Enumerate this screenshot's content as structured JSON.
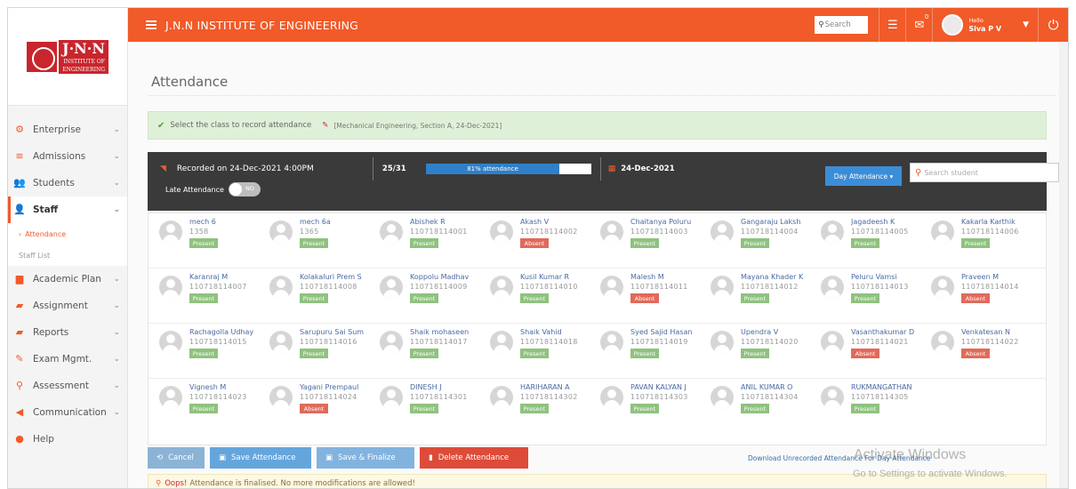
{
  "sidebar": {
    "logo_main": "J·N·N",
    "logo_sub1": "INSTITUTE OF",
    "logo_sub2": "ENGINEERING",
    "items": [
      {
        "label": "Enterprise",
        "icon": "gears-icon"
      },
      {
        "label": "Admissions",
        "icon": "list-icon"
      },
      {
        "label": "Students",
        "icon": "users-icon"
      },
      {
        "label": "Staff",
        "icon": "user-icon"
      },
      {
        "label": "Academic Plan",
        "icon": "folder-icon"
      },
      {
        "label": "Assignment",
        "icon": "book-icon"
      },
      {
        "label": "Reports",
        "icon": "folder-open-icon"
      },
      {
        "label": "Exam Mgmt.",
        "icon": "edit-icon"
      },
      {
        "label": "Assessment",
        "icon": "search-icon"
      },
      {
        "label": "Communication",
        "icon": "megaphone-icon"
      },
      {
        "label": "Help",
        "icon": "question-icon"
      }
    ],
    "staff_sub": [
      {
        "label": "Attendance"
      },
      {
        "label": "Staff List"
      }
    ]
  },
  "topbar": {
    "title": "J.N.N INSTITUTE OF ENGINEERING",
    "search_placeholder": "Search",
    "mail_badge": "0",
    "hello": "Hello",
    "user_name": "Siva P V",
    "accent": "#f15a29"
  },
  "page": {
    "title": "Attendance",
    "notice_text": "Select the class to record attendance",
    "notice_detail": "[Mechanical Engineering, Section A, 24-Dec-2021]",
    "recorded_on": "Recorded on  24-Dec-2021 4:00PM",
    "count": "25/31",
    "progress_label": "81% attendance",
    "progress": 0.81,
    "date": "24-Dec-2021",
    "day_attendance_label": "Day Attendance ▾",
    "search_student_placeholder": "Search student",
    "late_attendance_label": "Late Attendance",
    "toggle_label": "NO"
  },
  "students": [
    {
      "name": "mech 6",
      "id": "1358",
      "status": "Present"
    },
    {
      "name": "mech 6a",
      "id": "1365",
      "status": "Present"
    },
    {
      "name": "Abishek R",
      "id": "110718114001",
      "status": "Present"
    },
    {
      "name": "Akash V",
      "id": "110718114002",
      "status": "Absent"
    },
    {
      "name": "Chaitanya Poluru",
      "id": "110718114003",
      "status": "Present"
    },
    {
      "name": "Gangaraju Laksh",
      "id": "110718114004",
      "status": "Present"
    },
    {
      "name": "Jagadeesh K",
      "id": "110718114005",
      "status": "Present"
    },
    {
      "name": "Kakarla Karthik",
      "id": "110718114006",
      "status": "Present"
    },
    {
      "name": "Karanraj M",
      "id": "110718114007",
      "status": "Present"
    },
    {
      "name": "Kolakaluri Prem S",
      "id": "110718114008",
      "status": "Present"
    },
    {
      "name": "Koppolu Madhav",
      "id": "110718114009",
      "status": "Present"
    },
    {
      "name": "Kusil Kumar R",
      "id": "110718114010",
      "status": "Present"
    },
    {
      "name": "Malesh M",
      "id": "110718114011",
      "status": "Absent"
    },
    {
      "name": "Mayana Khader K",
      "id": "110718114012",
      "status": "Present"
    },
    {
      "name": "Peluru Vamsi",
      "id": "110718114013",
      "status": "Present"
    },
    {
      "name": "Praveen M",
      "id": "110718114014",
      "status": "Absent"
    },
    {
      "name": "Rachagolla Udhay",
      "id": "110718114015",
      "status": "Present"
    },
    {
      "name": "Sarupuru Sai Sum",
      "id": "110718114016",
      "status": "Present"
    },
    {
      "name": "Shaik mohaseen",
      "id": "110718114017",
      "status": "Present"
    },
    {
      "name": "Shaik Vahid",
      "id": "110718114018",
      "status": "Present"
    },
    {
      "name": "Syed Sajid Hasan",
      "id": "110718114019",
      "status": "Present"
    },
    {
      "name": "Upendra V",
      "id": "110718114020",
      "status": "Present"
    },
    {
      "name": "Vasanthakumar D",
      "id": "110718114021",
      "status": "Absent"
    },
    {
      "name": "Venkatesan N",
      "id": "110718114022",
      "status": "Absent"
    },
    {
      "name": "Vignesh M",
      "id": "110718114023",
      "status": "Present"
    },
    {
      "name": "Yagani Prempaul",
      "id": "110718114024",
      "status": "Absent"
    },
    {
      "name": "DINESH J",
      "id": "110718114301",
      "status": "Present"
    },
    {
      "name": "HARIHARAN A",
      "id": "110718114302",
      "status": "Present"
    },
    {
      "name": "PAVAN KALYAN J",
      "id": "110718114303",
      "status": "Present"
    },
    {
      "name": "ANIL KUMAR O",
      "id": "110718114304",
      "status": "Present"
    },
    {
      "name": "RUKMANGATHAN",
      "id": "110718114305",
      "status": "Present"
    }
  ],
  "actions": {
    "cancel": "Cancel",
    "save": "Save Attendance",
    "finalize": "Save & Finalize",
    "delete": "Delete Attendance",
    "download": "Download Unrecorded Attendance For Day Attendance"
  },
  "alert": {
    "prefix": "Oops!",
    "text": "Attendance is finalised. No more modifications are allowed!"
  },
  "watermark": {
    "line1": "Activate Windows",
    "line2": "Go to Settings to activate Windows."
  }
}
